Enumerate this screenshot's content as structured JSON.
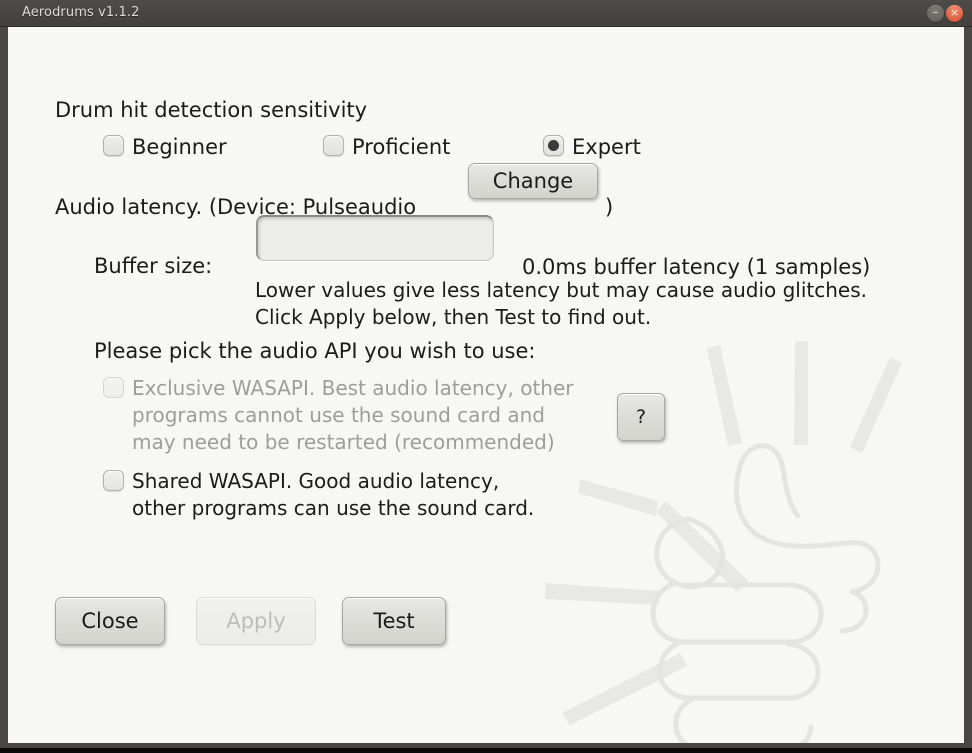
{
  "window": {
    "title": "Aerodrums v1.1.2",
    "minimize_label": "–",
    "close_label": "×",
    "minimize_icon": "minimize-icon",
    "close_icon": "close-icon"
  },
  "sensitivity": {
    "heading": "Drum hit detection sensitivity",
    "options": [
      {
        "label": "Beginner",
        "selected": false
      },
      {
        "label": "Proficient",
        "selected": false
      },
      {
        "label": "Expert",
        "selected": true
      }
    ]
  },
  "latency": {
    "label_prefix": "Audio latency.  (Device: Pulseaudio",
    "change_button": "Change",
    "label_suffix": ")",
    "buffer_label": "Buffer size:",
    "buffer_value": "",
    "buffer_placeholder": "",
    "buffer_info": "0.0ms buffer latency (1 samples)",
    "hint": "Lower values give less latency but may cause audio glitches.\nClick Apply below, then Test to find out."
  },
  "api": {
    "heading": "Please pick the audio API you wish to use:",
    "help_button": "?",
    "options": [
      {
        "label": "Exclusive WASAPI. Best audio latency, other\nprograms cannot use the sound card and\nmay need to be restarted (recommended)",
        "checked": false,
        "enabled": false
      },
      {
        "label": "Shared WASAPI. Good audio latency,\nother programs can use the sound card.",
        "checked": false,
        "enabled": true
      }
    ]
  },
  "actions": {
    "close": "Close",
    "apply": "Apply",
    "test": "Test",
    "apply_enabled": false
  },
  "colors": {
    "titlebar": "#474543",
    "close_button": "#e2684a",
    "content_background": "#f7f7f5",
    "text": "#1b1b1b",
    "disabled_text": "#9d9d9b",
    "watermark": "#e6e6e4"
  }
}
